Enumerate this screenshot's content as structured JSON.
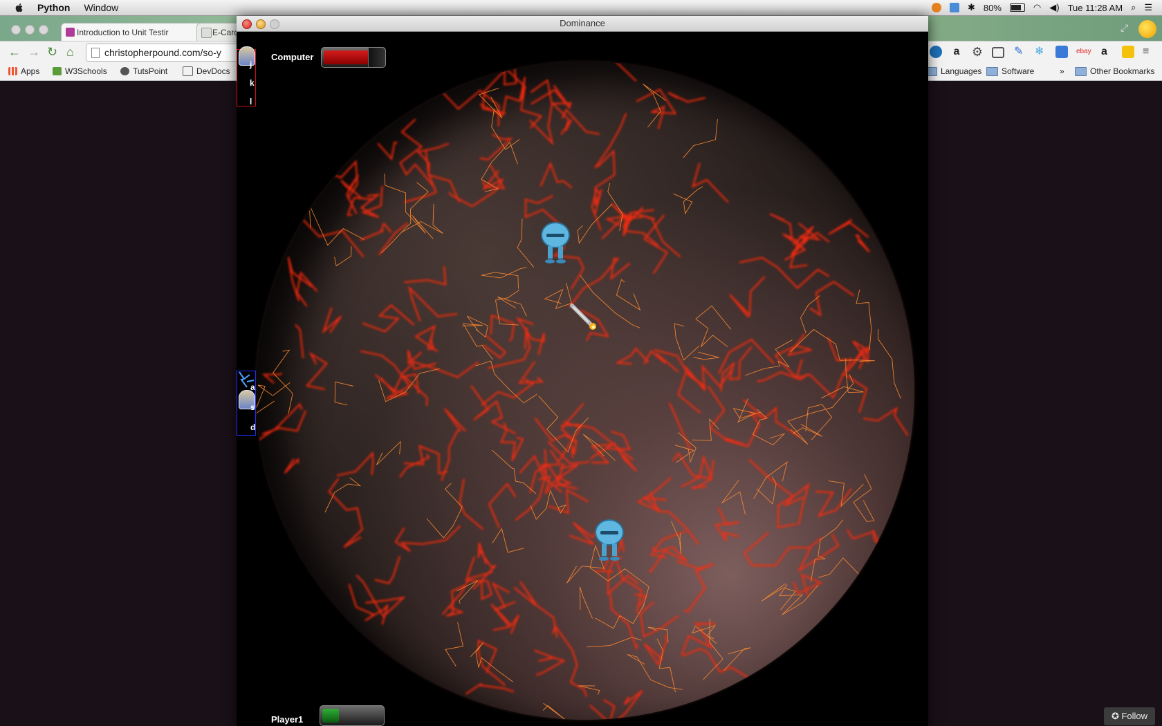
{
  "menubar": {
    "app_name": "Python",
    "menus": [
      "Window"
    ],
    "battery": "80%",
    "clock": "Tue 11:28 AM"
  },
  "browser": {
    "tabs": [
      {
        "label": "Introduction to Unit Testir",
        "close": "×"
      },
      {
        "label": "E-Card"
      }
    ],
    "url": "christopherpound.com/so-y",
    "bookmarks": [
      "Apps",
      "W3Schools",
      "TutsPoint",
      "DevDocs",
      "Languages",
      "Software",
      "Other Bookmarks"
    ],
    "overflow_chevron": "»",
    "follow_button": "Follow"
  },
  "game_window": {
    "title": "Dominance",
    "computer": {
      "label": "Computer",
      "health_fraction": 0.78,
      "health_color": "#b10000"
    },
    "player": {
      "label": "Player1",
      "health_fraction": 0.28,
      "health_color": "#1f8a24"
    },
    "computer_keys": [
      "j",
      "k",
      "l"
    ],
    "player_keys": [
      "a",
      "s",
      "d"
    ],
    "computer_panel_color": "#d01010",
    "player_panel_color": "#2030ff"
  },
  "icons": {
    "robot": "robot-icon",
    "missile": "missile-icon",
    "shield": "shield-icon",
    "lightning": "lightning-icon"
  }
}
